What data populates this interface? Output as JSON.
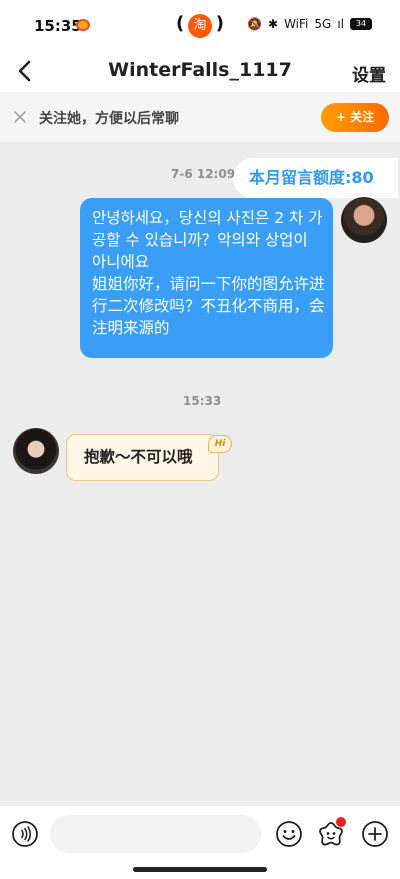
{
  "status_bar": {
    "time": "15:35",
    "island_left": "(",
    "island_right": ")",
    "island_app_glyph": "淘",
    "indicators": [
      "🔕",
      "✱",
      "WiFi",
      "5G",
      "ıl"
    ],
    "battery": "34"
  },
  "header": {
    "title": "WinterFalls_1117",
    "settings_label": "设置"
  },
  "follow_banner": {
    "text": "关注她，方便以后常聊",
    "button_label": "+ 关注"
  },
  "chat": {
    "quota_label": "本月留言额度:80",
    "messages": [
      {
        "timestamp": "7-6 12:09",
        "sender": "self",
        "text": "안녕하세요，당신의 사진은 2 차 가공할 수 있습니까？악의와 상업이 아니에요\n姐姐你好，请问一下你的图允许进行二次修改吗？不丑化不商用，会注明来源的"
      },
      {
        "timestamp": "15:33",
        "sender": "other",
        "text": "抱歉～不可以哦",
        "badge": "Hi"
      }
    ]
  },
  "input_bar": {
    "placeholder": ""
  },
  "colors": {
    "sent_bubble": "#3b9ef6",
    "received_bubble": "#fff7e6",
    "accent_orange": "#ff7a00",
    "quota_text": "#2e9bf0"
  },
  "icons": [
    "weibo-icon",
    "taobao-icon",
    "back-icon",
    "close-icon",
    "voice-icon",
    "emoji-icon",
    "sticker-icon",
    "add-icon"
  ]
}
